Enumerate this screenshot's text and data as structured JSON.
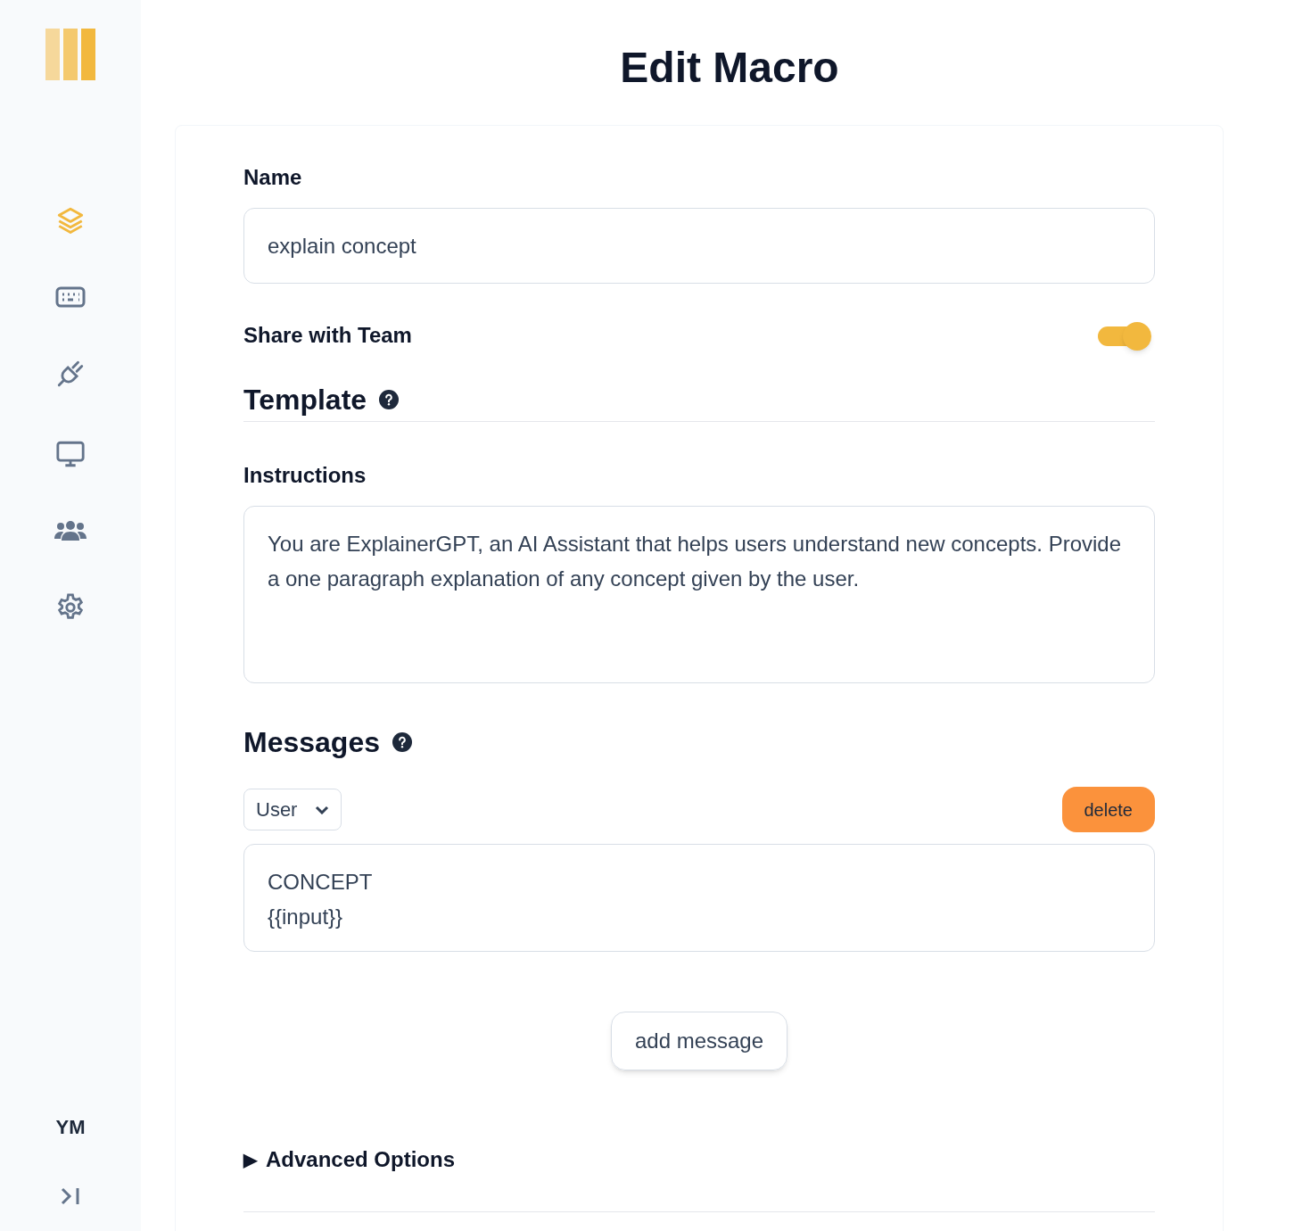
{
  "sidebar": {
    "nav_items": [
      {
        "selected": true
      },
      {
        "selected": false
      },
      {
        "selected": false
      },
      {
        "selected": false
      },
      {
        "selected": false
      },
      {
        "selected": false
      }
    ],
    "user_initials": "YM"
  },
  "title": "Edit Macro",
  "form": {
    "name_label": "Name",
    "name_value": "explain concept",
    "share_label": "Share with Team",
    "share_on": true,
    "template_heading": "Template",
    "instructions_label": "Instructions",
    "instructions_value": "You are ExplainerGPT, an AI Assistant that helps users understand new concepts. Provide a one paragraph explanation of any concept given by the user.",
    "messages_heading": "Messages",
    "messages": [
      {
        "role": "User",
        "content": "CONCEPT\n{{input}}",
        "delete_label": "delete"
      }
    ],
    "add_message_label": "add message",
    "advanced_marker": "▶",
    "advanced_label": "Advanced Options",
    "advanced_expanded": false
  }
}
